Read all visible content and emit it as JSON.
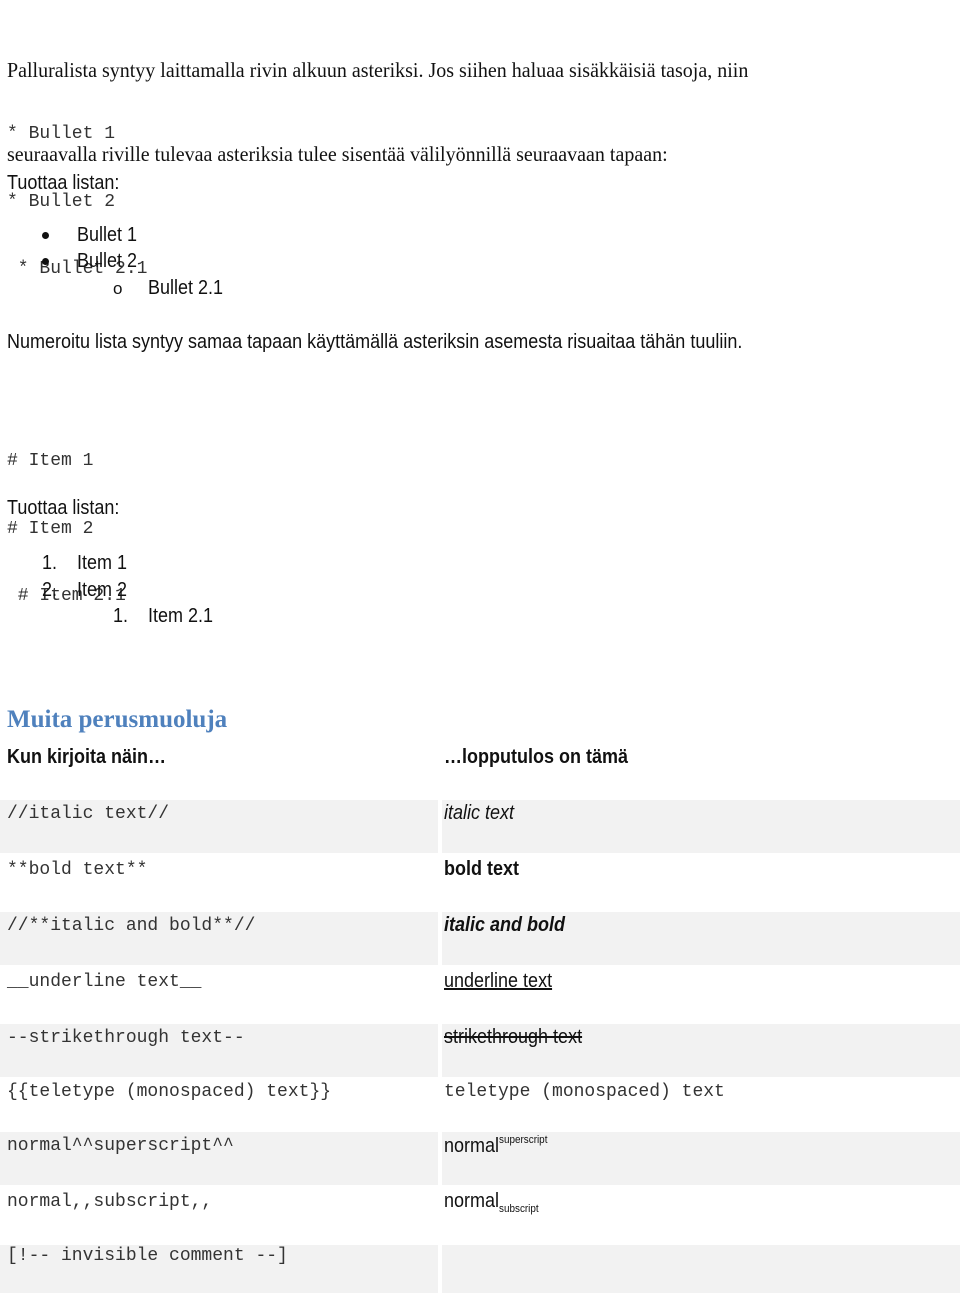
{
  "intro": {
    "line1": "Palluralista syntyy laittamalla rivin alkuun asteriksi. Jos siihen haluaa sisäkkäisiä tasoja, niin",
    "line2": "seuraavalla riville tulevaa asteriksia tulee sisentää välilyönnillä seuraavaan tapaan:"
  },
  "bullet_code": [
    "* Bullet 1",
    "* Bullet 2",
    " * Bullet 2.1"
  ],
  "bullet_result_label": "Tuottaa listan:",
  "bullet_result": {
    "items": [
      "Bullet 1",
      "Bullet 2"
    ],
    "sub_marker": "o",
    "sub_items": [
      "Bullet 2.1"
    ]
  },
  "numbered_intro": "Numeroitu lista syntyy samaa tapaan käyttämällä asteriksin asemesta risuaitaa tähän tuuliin.",
  "numbered_code": [
    "# Item 1",
    "# Item 2",
    " # Item 2.1"
  ],
  "numbered_result_label": "Tuottaa listan:",
  "numbered_result": {
    "items": [
      {
        "marker": "1.",
        "label": "Item 1"
      },
      {
        "marker": "2.",
        "label": "Item 2"
      }
    ],
    "sub_items": [
      {
        "marker": "1.",
        "label": "Item 2.1"
      }
    ]
  },
  "section": {
    "heading": "Muita perusmuoluja",
    "colors": {
      "heading": "#4f81bd",
      "row_shade": "#f2f2f2"
    },
    "table": {
      "headers": [
        "Kun kirjoita näin…",
        "…lopputulos on tämä"
      ],
      "rows": [
        {
          "source": "//italic text//",
          "result": "italic text",
          "style": "italic"
        },
        {
          "source": "**bold text**",
          "result": "bold text",
          "style": "bold"
        },
        {
          "source": "//**italic and bold**//",
          "result": "italic and bold",
          "style": "bold-italic"
        },
        {
          "source": "__underline text__",
          "result": "underline text",
          "style": "underline"
        },
        {
          "source": "--strikethrough text--",
          "result": "strikethrough text",
          "style": "strikethrough"
        },
        {
          "source": "{{teletype (monospaced) text}}",
          "result": "teletype (monospaced) text",
          "style": "monospace"
        },
        {
          "source": "normal^^superscript^^",
          "result": "normal",
          "extra": "superscript",
          "style": "superscript"
        },
        {
          "source": "normal,,subscript,,",
          "result": "normal",
          "extra": "subscript",
          "style": "subscript"
        },
        {
          "source": "[!-- invisible comment --]",
          "result": "",
          "style": "hidden"
        }
      ]
    }
  }
}
